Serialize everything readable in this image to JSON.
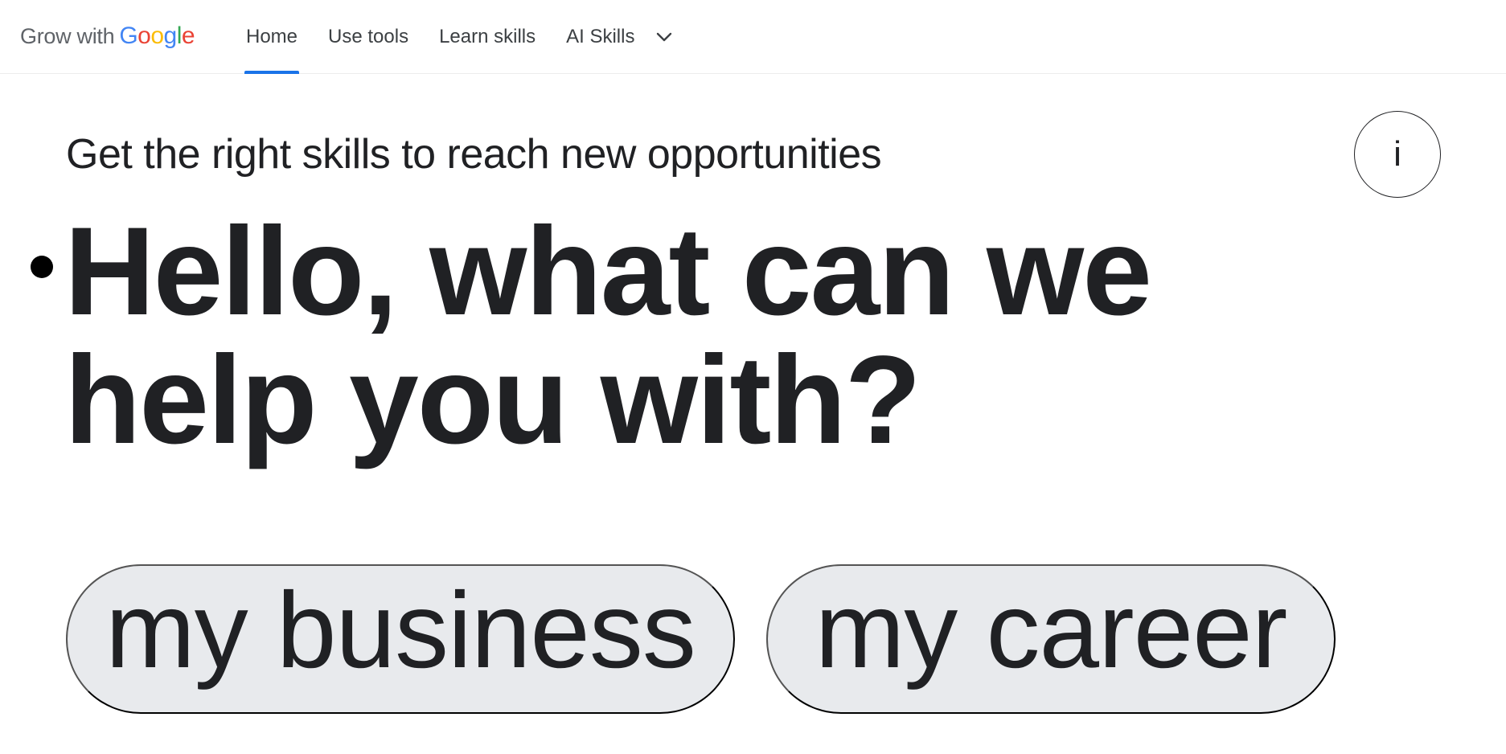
{
  "header": {
    "logo_prefix": "Grow with",
    "logo_letters": [
      {
        "char": "G",
        "color": "#4285F4"
      },
      {
        "char": "o",
        "color": "#EA4335"
      },
      {
        "char": "o",
        "color": "#FBBC05"
      },
      {
        "char": "g",
        "color": "#4285F4"
      },
      {
        "char": "l",
        "color": "#34A853"
      },
      {
        "char": "e",
        "color": "#EA4335"
      }
    ],
    "nav": [
      {
        "label": "Home",
        "active": true
      },
      {
        "label": "Use tools",
        "active": false
      },
      {
        "label": "Learn skills",
        "active": false
      },
      {
        "label": "AI Skills",
        "active": false
      }
    ],
    "dropdown_icon": "chevron-down-icon"
  },
  "hero": {
    "subtitle": "Get the right skills to reach new opportunities",
    "headline": "Hello, what can we help you with?",
    "info_label": "i"
  },
  "chips": {
    "business": "my business",
    "career": "my career"
  },
  "colors": {
    "accent": "#1a73e8",
    "chip_bg": "#e8eaed",
    "text": "#202124"
  }
}
